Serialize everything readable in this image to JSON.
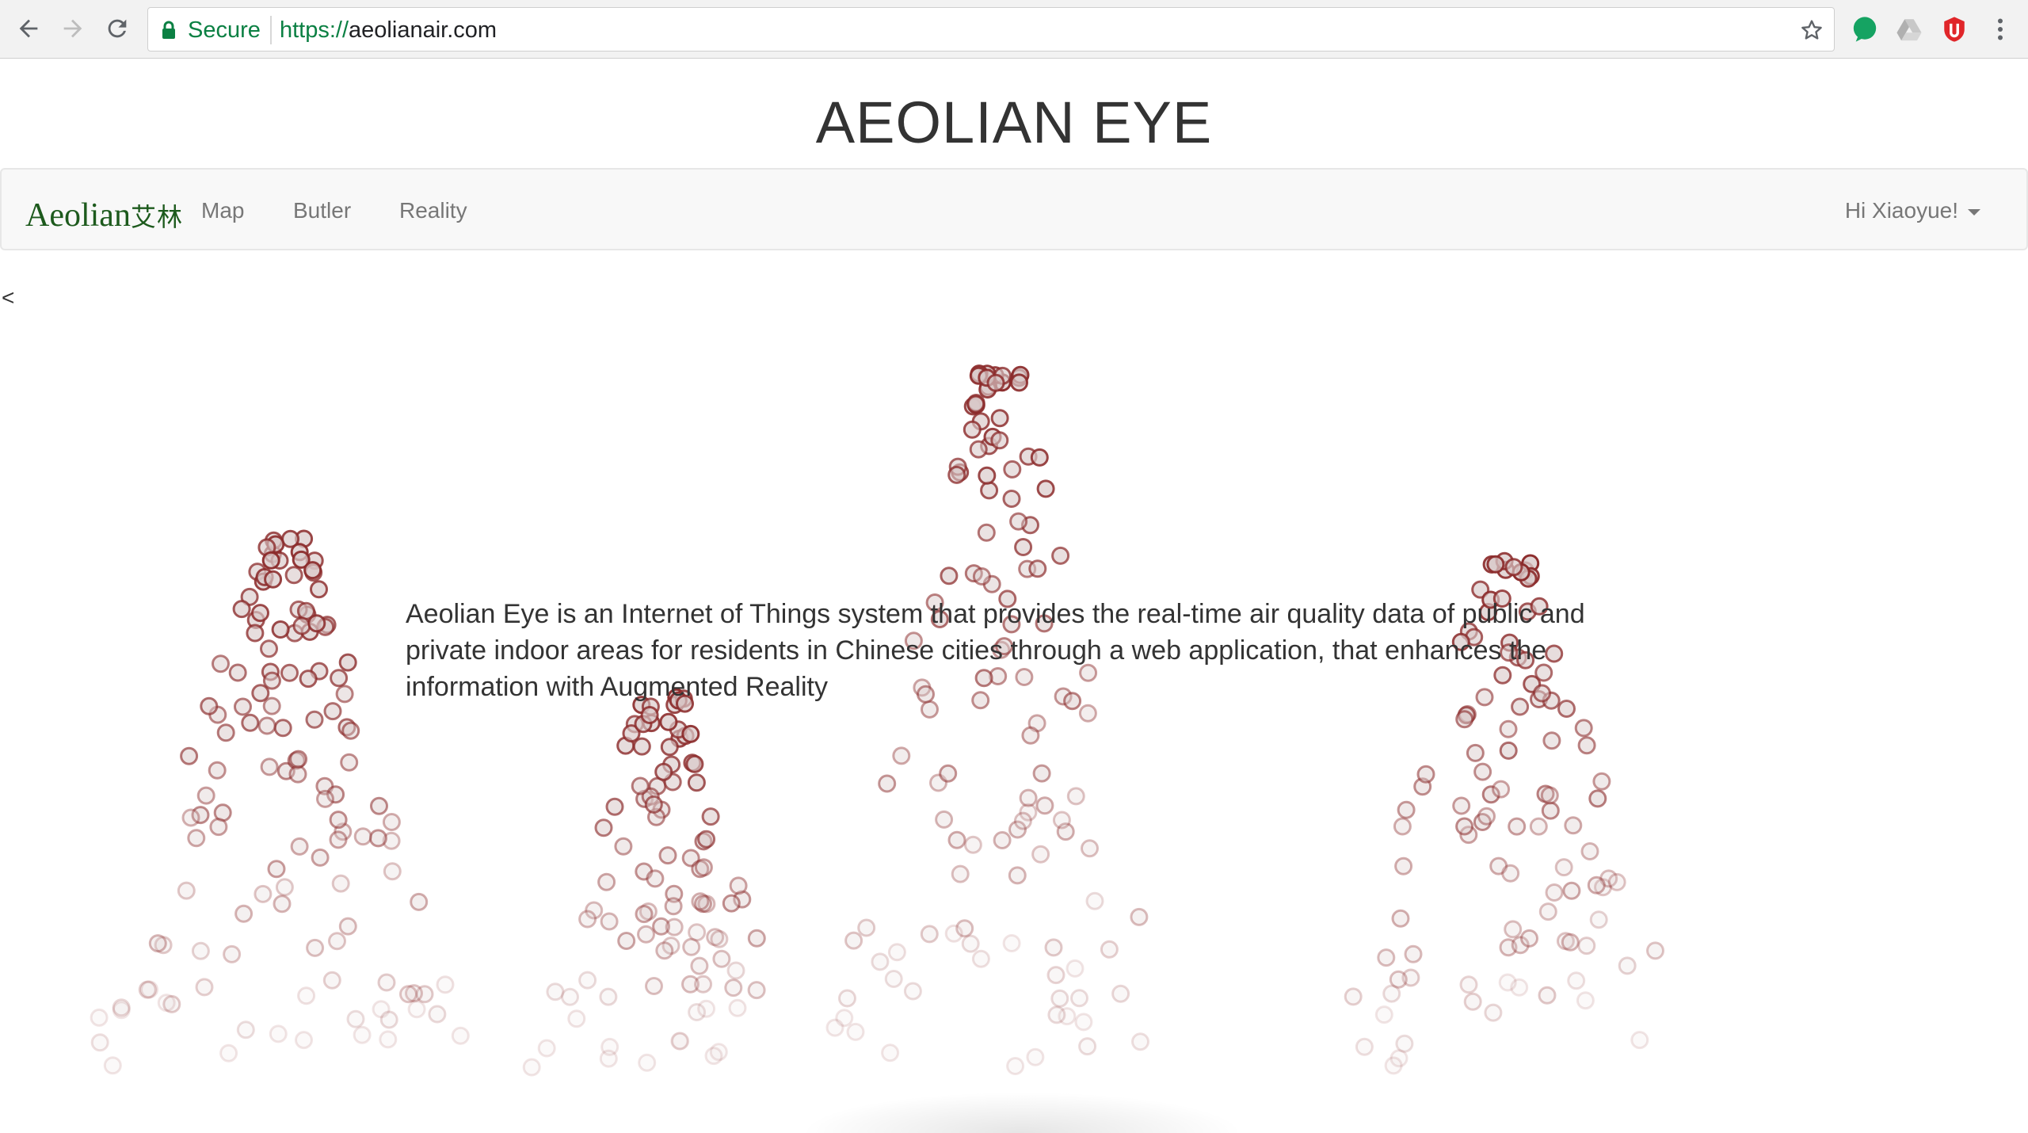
{
  "browser": {
    "secure_label": "Secure",
    "url_scheme": "https://",
    "url_host": "aeolianair.com",
    "icons": [
      "back-arrow-icon",
      "forward-arrow-icon",
      "reload-icon",
      "lock-icon",
      "star-icon",
      "green-extension-icon",
      "drive-icon",
      "shield-extension-icon",
      "more-menu-icon"
    ]
  },
  "page": {
    "title": "AEOLIAN EYE",
    "stray_char": "<",
    "description": "Aeolian Eye is an Internet of Things system that provides the real-time air quality data of public and private indoor areas for residents in Chinese cities through a web application, that enhances the information with Augmented Reality"
  },
  "navbar": {
    "brand": {
      "latin": "Aeolian",
      "chinese": "艾林",
      "color": "#1d5a1d"
    },
    "links": [
      "Map",
      "Butler",
      "Reality"
    ],
    "user_menu": "Hi Xiaoyue!"
  },
  "visualization": {
    "particle_stroke": "#8b2a2a",
    "particle_fill": "#d8c8c8",
    "clusters": 4
  }
}
